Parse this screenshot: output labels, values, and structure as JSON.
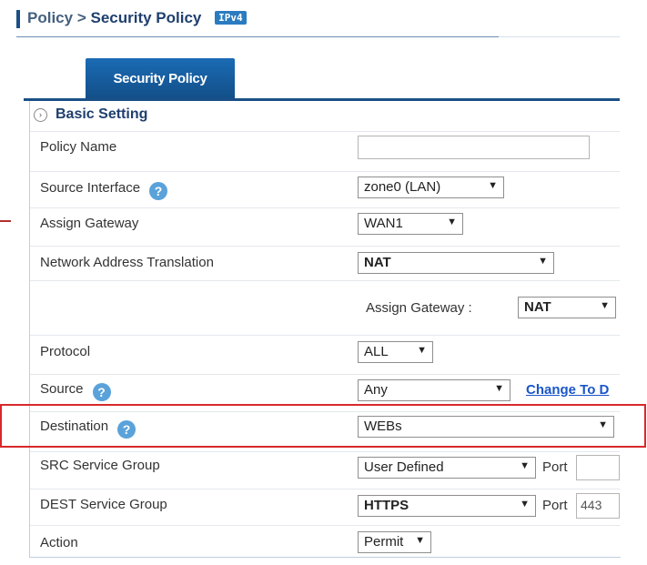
{
  "breadcrumb": {
    "root": "Policy",
    "sep": ">",
    "current": "Security Policy",
    "badge": "IPv4"
  },
  "tab": {
    "label": "Security Policy"
  },
  "section": {
    "title": "Basic Setting"
  },
  "fields": {
    "policy_name": {
      "label": "Policy Name",
      "value": ""
    },
    "source_interface": {
      "label": "Source Interface",
      "value": "zone0 (LAN)"
    },
    "assign_gateway": {
      "label": "Assign Gateway",
      "value": "WAN1"
    },
    "nat": {
      "label": "Network Address Translation",
      "value": "NAT"
    },
    "nat_gateway": {
      "label": "Assign Gateway :",
      "value": "NAT"
    },
    "protocol": {
      "label": "Protocol",
      "value": "ALL"
    },
    "source": {
      "label": "Source",
      "value": "Any",
      "link": "Change To D"
    },
    "destination": {
      "label": "Destination",
      "value": "WEBs"
    },
    "src_service": {
      "label": "SRC Service Group",
      "value": "User Defined",
      "port_label": "Port",
      "port_value": ""
    },
    "dest_service": {
      "label": "DEST Service Group",
      "value": "HTTPS",
      "port_label": "Port",
      "port_value": "443"
    },
    "action": {
      "label": "Action",
      "value": "Permit"
    }
  },
  "help_glyph": "?",
  "arrow_glyph": "▼"
}
